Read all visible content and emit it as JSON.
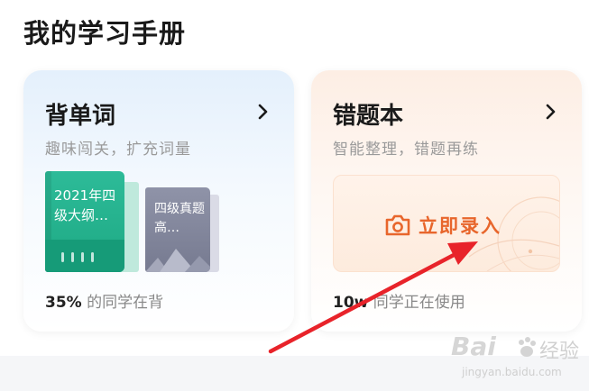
{
  "section": {
    "title": "我的学习手册"
  },
  "vocab_card": {
    "title": "背单词",
    "subtitle": "趣味闯关，扩充词量",
    "book1": "2021年四级大纲…",
    "book2": "四级真题高…",
    "footer_percent": "35%",
    "footer_text": "的同学在背"
  },
  "mistake_card": {
    "title": "错题本",
    "subtitle": "智能整理，错题再练",
    "action_label": "立即录入",
    "footer_prefix": "10w",
    "footer_text": "同学正在使用"
  },
  "watermark": {
    "logo": "Bai",
    "brand": "经验",
    "url": "jingyan.baidu.com"
  },
  "colors": {
    "accent_orange": "#e8662c",
    "annotation_red": "#e8232a",
    "book_green": "#1ea984",
    "book_gray": "#767a90"
  }
}
